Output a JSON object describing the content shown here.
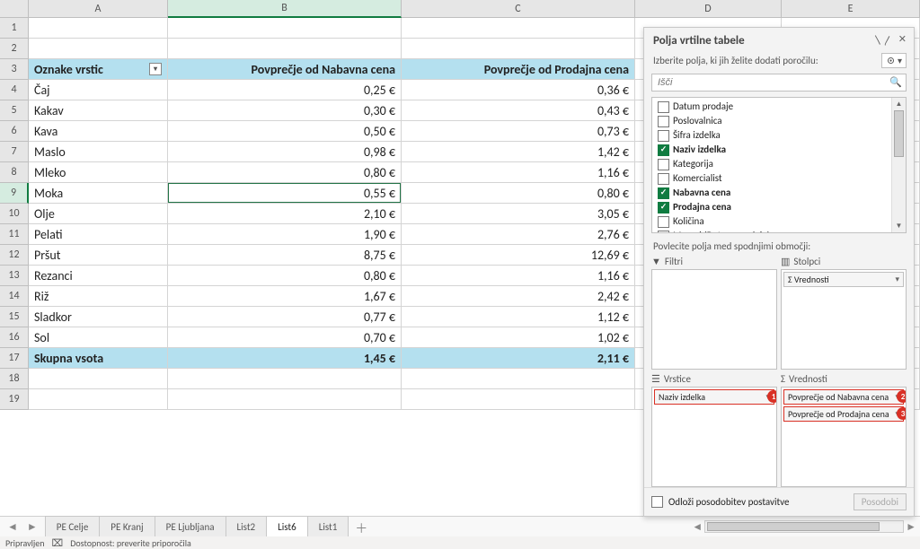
{
  "columns": [
    "A",
    "B",
    "C",
    "D",
    "E"
  ],
  "selected_cell": {
    "row": 9,
    "col": "B"
  },
  "pivot": {
    "header": {
      "rowlabel": "Oznake vrstic",
      "col2": "Povprečje od Nabavna cena",
      "col3": "Povprečje od Prodajna cena"
    },
    "rows": [
      {
        "label": "Čaj",
        "c2": "0,25 €",
        "c3": "0,36 €"
      },
      {
        "label": "Kakav",
        "c2": "0,30 €",
        "c3": "0,43 €"
      },
      {
        "label": "Kava",
        "c2": "0,50 €",
        "c3": "0,73 €"
      },
      {
        "label": "Maslo",
        "c2": "0,98 €",
        "c3": "1,42 €"
      },
      {
        "label": "Mleko",
        "c2": "0,80 €",
        "c3": "1,16 €"
      },
      {
        "label": "Moka",
        "c2": "0,55 €",
        "c3": "0,80 €"
      },
      {
        "label": "Olje",
        "c2": "2,10 €",
        "c3": "3,05 €"
      },
      {
        "label": "Pelati",
        "c2": "1,90 €",
        "c3": "2,76 €"
      },
      {
        "label": "Pršut",
        "c2": "8,75 €",
        "c3": "12,69 €"
      },
      {
        "label": "Rezanci",
        "c2": "0,80 €",
        "c3": "1,16 €"
      },
      {
        "label": "Riž",
        "c2": "1,67 €",
        "c3": "2,42 €"
      },
      {
        "label": "Sladkor",
        "c2": "0,77 €",
        "c3": "1,12 €"
      },
      {
        "label": "Sol",
        "c2": "0,70 €",
        "c3": "1,02 €"
      }
    ],
    "total": {
      "label": "Skupna vsota",
      "c2": "1,45 €",
      "c3": "2,11 €"
    }
  },
  "pane": {
    "title": "Polja vrtilne tabele",
    "subtitle": "Izberite polja, ki jih želite dodati poročilu:",
    "search_placeholder": "Išči",
    "fields": [
      {
        "name": "Datum prodaje",
        "checked": false
      },
      {
        "name": "Poslovalnica",
        "checked": false
      },
      {
        "name": "Šifra izdelka",
        "checked": false
      },
      {
        "name": "Naziv izdelka",
        "checked": true
      },
      {
        "name": "Kategorija",
        "checked": false
      },
      {
        "name": "Komercialist",
        "checked": false
      },
      {
        "name": "Nabavna cena",
        "checked": true
      },
      {
        "name": "Prodajna cena",
        "checked": true
      },
      {
        "name": "Količina",
        "checked": false
      },
      {
        "name": "Meseci (Datum prodaje)",
        "checked": false
      }
    ],
    "areas_hint": "Povlecite polja med spodnjimi območji:",
    "areas": {
      "filters_label": "Filtri",
      "columns_label": "Stolpci",
      "rows_label": "Vrstice",
      "values_label": "Vrednosti",
      "columns_items": [
        {
          "text": "Σ  Vrednosti",
          "red": false
        }
      ],
      "rows_items": [
        {
          "text": "Naziv izdelka",
          "red": true,
          "badge": "1"
        }
      ],
      "values_items": [
        {
          "text": "Povprečje od Nabavna cena",
          "red": true,
          "badge": "2"
        },
        {
          "text": "Povprečje od Prodajna cena",
          "red": true,
          "badge": "3"
        }
      ]
    },
    "defer_label": "Odloži posodobitev postavitve",
    "update_label": "Posodobi"
  },
  "tabs": [
    "PE Celje",
    "PE Kranj",
    "PE Ljubljana",
    "List2",
    "List6",
    "List1"
  ],
  "active_tab": "List6",
  "status": {
    "ready": "Pripravljen",
    "acc": "Dostopnost: preverite priporočila"
  }
}
